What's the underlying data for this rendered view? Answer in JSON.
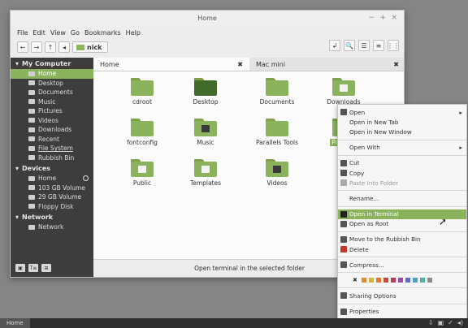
{
  "window": {
    "title": "Home",
    "controls": [
      "−",
      "+",
      "×"
    ]
  },
  "menubar": [
    "File",
    "Edit",
    "View",
    "Go",
    "Bookmarks",
    "Help"
  ],
  "toolbar": {
    "back": "←",
    "forward": "→",
    "up": "↑",
    "toggle": "◂",
    "breadcrumb": "nick",
    "right_buttons": [
      "↲",
      "🔍",
      "☰",
      "≡",
      "⋮⋮"
    ]
  },
  "sidebar": {
    "sections": [
      {
        "title": "My Computer",
        "items": [
          "Home",
          "Desktop",
          "Documents",
          "Music",
          "Pictures",
          "Videos",
          "Downloads",
          "Recent",
          "File System",
          "Rubbish Bin"
        ]
      },
      {
        "title": "Devices",
        "items": [
          "Home",
          "103 GB Volume",
          "29 GB Volume",
          "Floppy Disk"
        ]
      },
      {
        "title": "Network",
        "items": [
          "Network"
        ]
      }
    ],
    "footer_buttons": [
      "▣",
      "T≡",
      "⊞"
    ]
  },
  "tabs": [
    {
      "label": "Home",
      "close": "✖"
    },
    {
      "label": "Mac mini",
      "close": "✖"
    }
  ],
  "items": [
    {
      "label": "cdroot"
    },
    {
      "label": "Desktop"
    },
    {
      "label": "Documents"
    },
    {
      "label": "Downloads"
    },
    {
      "label": "fontconfig"
    },
    {
      "label": "Music"
    },
    {
      "label": "Parallels Tools"
    },
    {
      "label": "Pictures"
    },
    {
      "label": "Public"
    },
    {
      "label": "Templates"
    },
    {
      "label": "Videos"
    }
  ],
  "status": "Open terminal in the selected folder",
  "context_menu": {
    "items": [
      "Open",
      "Open in New Tab",
      "Open in New Window",
      "Open With",
      "Cut",
      "Copy",
      "Paste Into Folder",
      "Rename...",
      "Open in Terminal",
      "Open as Root",
      "Move to the Rubbish Bin",
      "Delete",
      "Compress...",
      "Sharing Options",
      "Properties"
    ],
    "swatch_close": "✖",
    "swatches": [
      "#e08a3c",
      "#d9b33b",
      "#e0782f",
      "#c84a3a",
      "#b63a5c",
      "#9b4aa8",
      "#5b6fc8",
      "#4ea0c8",
      "#55b0a0",
      "#8b8b8b"
    ]
  },
  "taskbar": {
    "start": "Home",
    "tray": [
      "⇩",
      "▣",
      "✓",
      "◂)"
    ]
  }
}
